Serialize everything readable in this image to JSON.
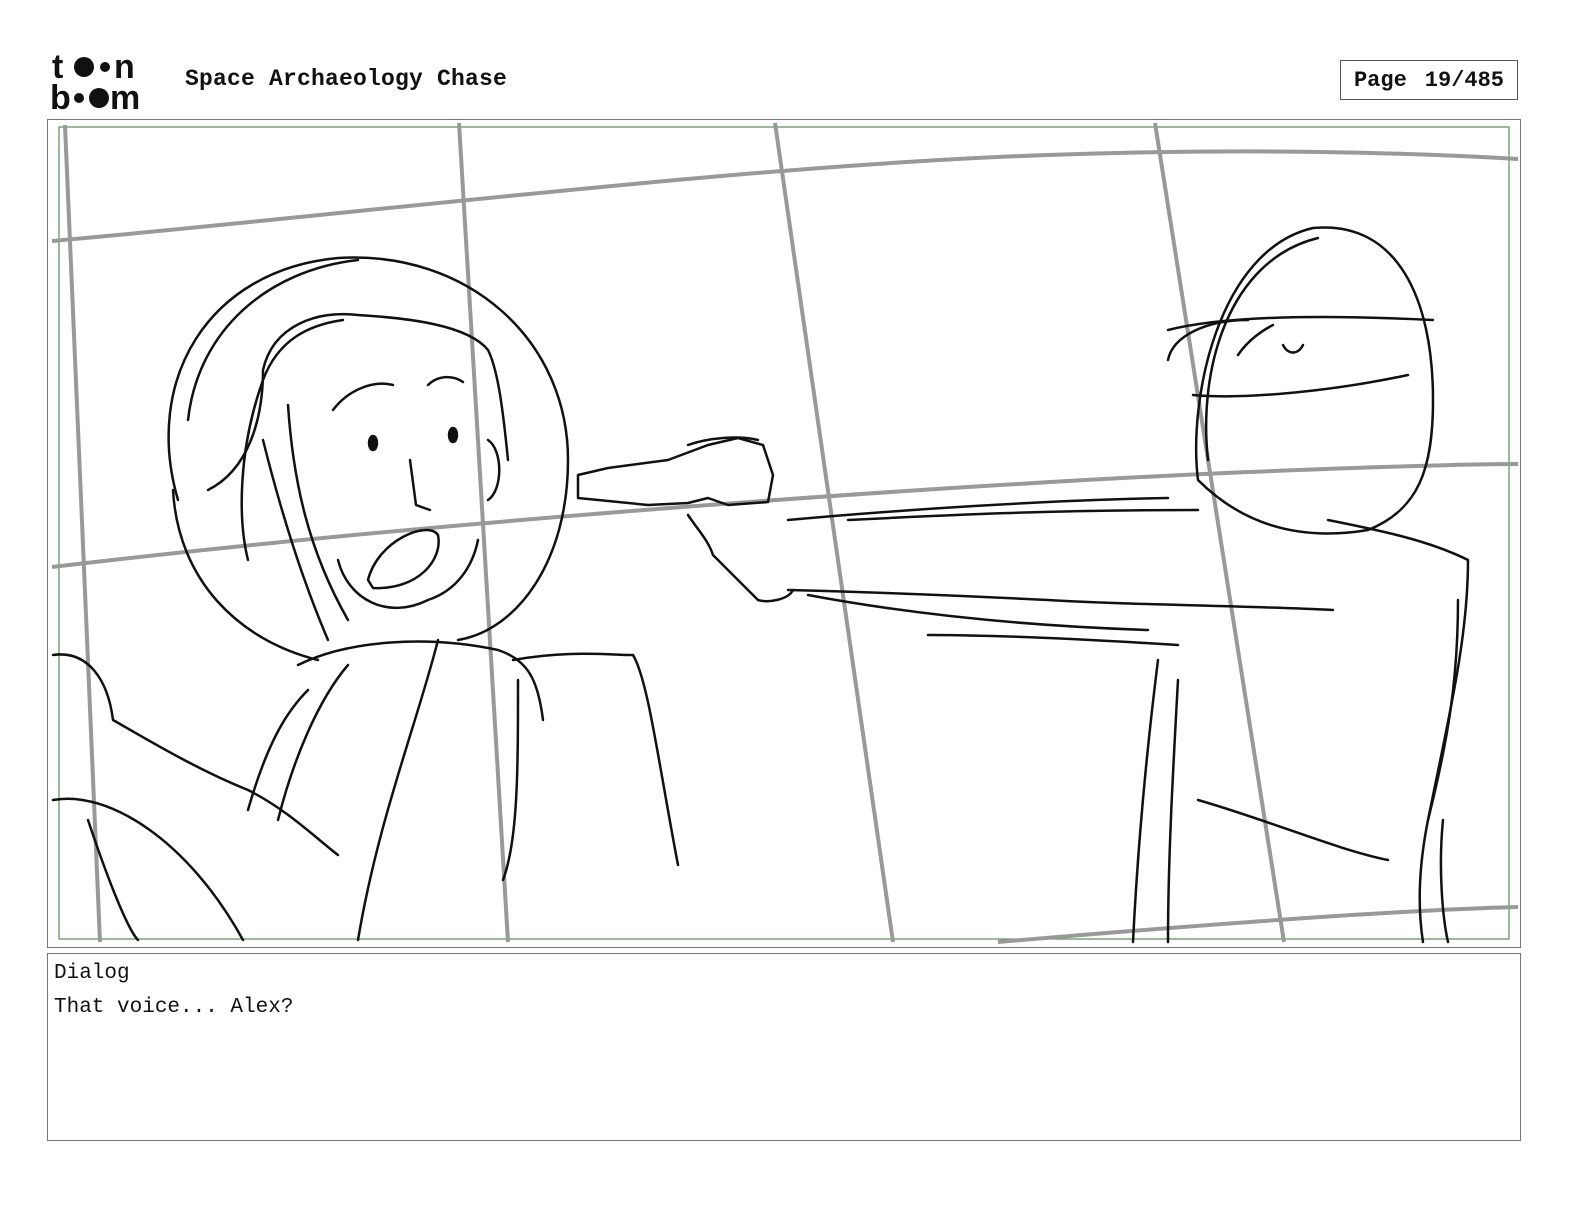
{
  "header": {
    "logo_line1": "toon",
    "logo_line2": "boom",
    "project_title": "Space Archaeology Chase",
    "page_label": "Page",
    "page_number": "19/485"
  },
  "panel": {
    "image": "storyboard-sketch",
    "description": "rough pencil storyboard sketch"
  },
  "dialog": {
    "label": "Dialog",
    "text": "That voice... Alex?"
  }
}
